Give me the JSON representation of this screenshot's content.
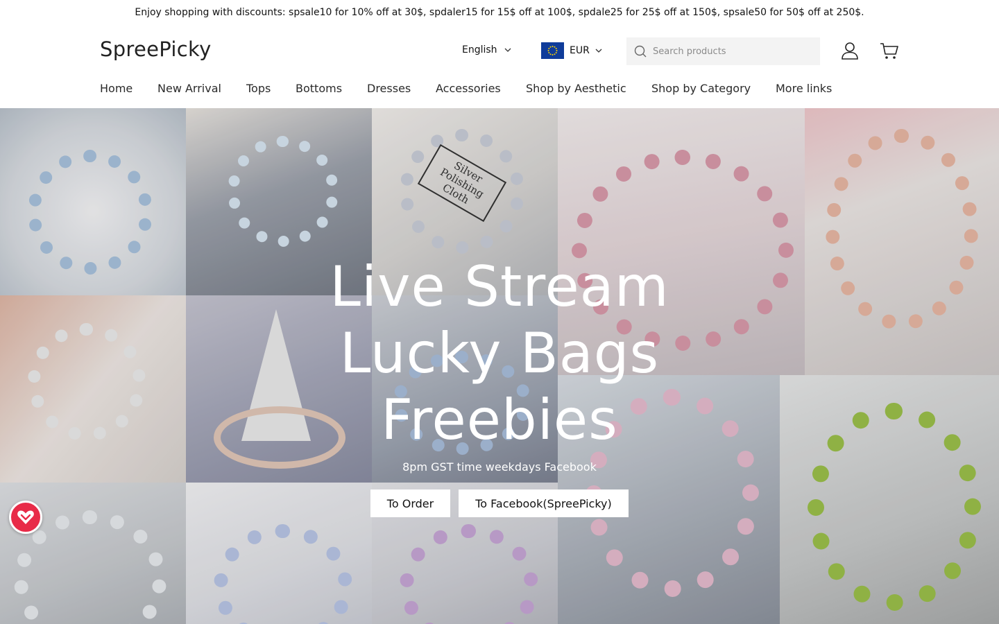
{
  "announcement": "Enjoy shopping with discounts: spsale10 for 10% off at 30$, spdaler15 for 15$ off at 100$, spdale25 for 25$ off at 150$, spsale50 for 50$ off at 250$.",
  "header": {
    "logo": "SpreePicky",
    "language": "English",
    "currency": "EUR",
    "search_placeholder": "Search products",
    "account_icon": "user-icon",
    "cart_icon": "cart-icon"
  },
  "nav": {
    "items": [
      "Home",
      "New Arrival",
      "Tops",
      "Bottoms",
      "Dresses",
      "Accessories",
      "Shop by Aesthetic",
      "Shop by Category",
      "More links"
    ]
  },
  "hero": {
    "title_line1": "Live Stream",
    "title_line2": "Lucky Bags",
    "title_line3": "Freebies",
    "subtitle": "8pm GST time weekdays Facebook",
    "button_order": "To Order",
    "button_facebook": "To Facebook(SpreePicky)",
    "image_text": "Silver Polishing Cloth"
  },
  "floating_widget": {
    "icon": "rewards-heart-icon",
    "color": "#e82b48"
  }
}
